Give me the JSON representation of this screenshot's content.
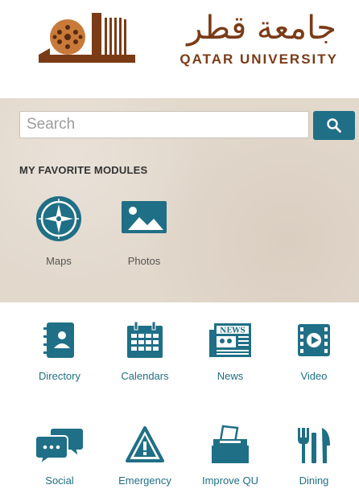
{
  "header": {
    "logo_arabic": "جامعة قطر",
    "logo_english": "QATAR UNIVERSITY"
  },
  "search": {
    "placeholder": "Search",
    "value": ""
  },
  "favorites": {
    "title": "MY FAVORITE MODULES",
    "items": [
      {
        "label": "Maps",
        "icon": "compass-icon"
      },
      {
        "label": "Photos",
        "icon": "photos-icon"
      }
    ]
  },
  "modules": [
    {
      "label": "Directory",
      "icon": "directory-icon"
    },
    {
      "label": "Calendars",
      "icon": "calendar-icon"
    },
    {
      "label": "News",
      "icon": "newspaper-icon"
    },
    {
      "label": "Video",
      "icon": "video-icon"
    },
    {
      "label": "Social",
      "icon": "chat-bubbles-icon"
    },
    {
      "label": "Emergency",
      "icon": "warning-icon"
    },
    {
      "label": "Improve QU",
      "icon": "ballot-box-icon"
    },
    {
      "label": "Dining",
      "icon": "utensils-icon"
    }
  ],
  "colors": {
    "accent": "#1f6f86",
    "brand": "#7b3b16",
    "panel_bg": "#e2d8cc"
  }
}
